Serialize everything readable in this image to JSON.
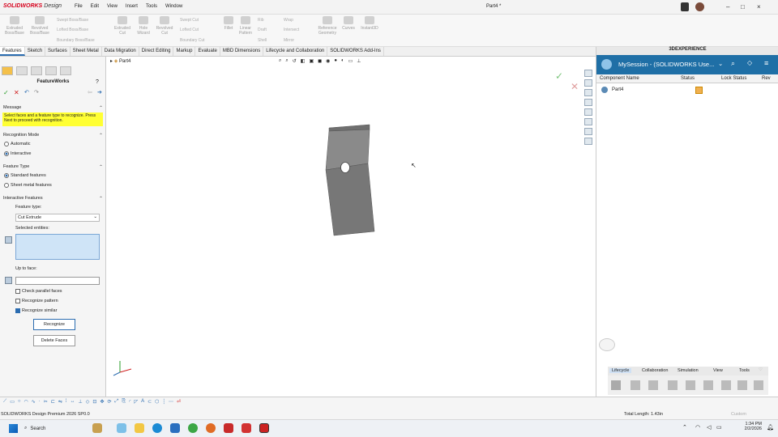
{
  "app": {
    "logo_brand": "SOLIDWORKS",
    "logo_suffix": "Design",
    "doc_title": "Part4 *"
  },
  "menu": [
    "File",
    "Edit",
    "View",
    "Insert",
    "Tools",
    "Window"
  ],
  "ribbon": {
    "large": [
      "Extruded Boss/Base",
      "Revolved Boss/Base",
      "Extruded Cut",
      "Hole Wizard",
      "Revolved Cut",
      "Fillet",
      "Linear Pattern",
      "Reference Geometry",
      "Curves",
      "Instant3D"
    ],
    "small": [
      "Swept Boss/Base",
      "Lofted Boss/Base",
      "Boundary Boss/Base",
      "Swept Cut",
      "Lofted Cut",
      "Boundary Cut",
      "Rib",
      "Draft",
      "Shell",
      "Wrap",
      "Intersect",
      "Mirror"
    ]
  },
  "tabs": [
    "Features",
    "Sketch",
    "Surfaces",
    "Sheet Metal",
    "Data Migration",
    "Direct Editing",
    "Markup",
    "Evaluate",
    "MBD Dimensions",
    "Lifecycle and Collaboration",
    "SOLIDWORKS Add-Ins"
  ],
  "property_manager": {
    "title": "FeatureWorks",
    "message_header": "Message",
    "message": "Select faces and a feature type to recognize. Press Next to proceed with recognition.",
    "recognition_mode": {
      "header": "Recognition Mode",
      "options": [
        "Automatic",
        "Interactive"
      ],
      "selected": "Interactive"
    },
    "feature_type": {
      "header": "Feature Type",
      "options": [
        "Standard features",
        "Sheet metal features"
      ],
      "selected": "Standard features"
    },
    "interactive": {
      "header": "Interactive Features",
      "feature_type_label": "Feature type:",
      "feature_type_value": "Cut Extrude",
      "selected_entities_label": "Selected entities:",
      "up_to_face_label": "Up to face:",
      "checks": [
        {
          "label": "Check parallel faces",
          "checked": false
        },
        {
          "label": "Recognize pattern",
          "checked": false
        },
        {
          "label": "Recognize similar",
          "checked": true
        }
      ],
      "recognize_button": "Recognize",
      "delete_faces_button": "Delete Faces"
    }
  },
  "viewport": {
    "tree_root": "Part4"
  },
  "experience": {
    "header": "3DEXPERIENCE",
    "session": "MySession - (SOLIDWORKS Use...",
    "columns": [
      "Component Name",
      "Status",
      "Lock Status",
      "Rev"
    ],
    "rows": [
      {
        "name": "Part4"
      }
    ],
    "bottom_tabs": [
      "Lifecycle",
      "Collaboration",
      "Simulation",
      "View",
      "Tools"
    ],
    "active_tab": "Lifecycle"
  },
  "status": {
    "left": "SOLIDWORKS Design Premium 2026 SP0.0",
    "total_length": "Total Length: 1.43in",
    "mode": "Custom"
  },
  "taskbar": {
    "search_placeholder": "Search",
    "time": "1:34 PM",
    "date": "2/2/2026"
  },
  "colors": {
    "accent": "#2b6cb0",
    "message_bg": "#ffff33",
    "experience_bar": "#1f6fa6",
    "brand": "#d6001c"
  }
}
